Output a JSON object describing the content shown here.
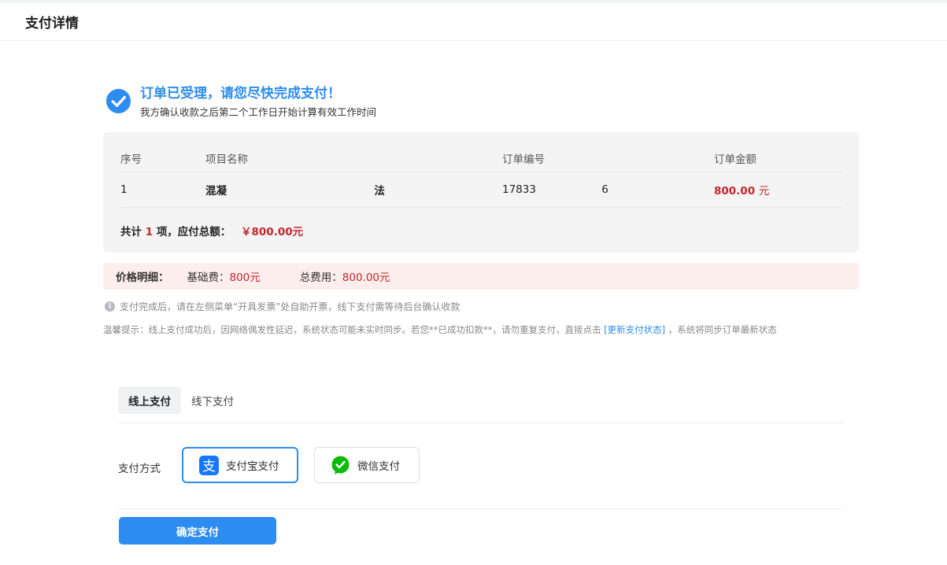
{
  "header": {
    "title": "支付详情"
  },
  "success": {
    "headline": "订单已受理，请您尽快完成支付！",
    "subline": "我方确认收款之后第二个工作日开始计算有效工作时间"
  },
  "order": {
    "columns": {
      "seq": "序号",
      "name": "项目名称",
      "no": "订单编号",
      "amount": "订单金额"
    },
    "row": {
      "seq": "1",
      "name_start": "混凝",
      "name_end": "法",
      "no_start": "17833",
      "no_end": "6",
      "amount": "800.00",
      "amount_unit": "元"
    },
    "total": {
      "prefix": "共计",
      "count": "1",
      "middle": "项，应付总额：",
      "money": "￥800.00元"
    }
  },
  "price_detail": {
    "label": "价格明细：",
    "base_key": "基础费：",
    "base_val": "800元",
    "sum_key": "总费用：",
    "sum_val": "800.00元"
  },
  "notice": "支付完成后，请在左侧菜单“开具发票”处自助开票，线下支付需等待后台确认收款",
  "tip": {
    "before": "温馨提示：线上支付成功后，因网络偶发性延迟，系统状态可能未实时同步。若您**已成功扣款**，请勿重复支付，直接点击",
    "link": "[更新支付状态]",
    "after": "，系统将同步订单最新状态"
  },
  "tabs": [
    {
      "label": "线上支付",
      "active": true
    },
    {
      "label": "线下支付",
      "active": false
    }
  ],
  "payment": {
    "label": "支付方式",
    "alipay": "支付宝支付",
    "wechat": "微信支付"
  },
  "confirm_label": "确定支付",
  "colors": {
    "primary": "#2d8cf0",
    "price": "#c3272b",
    "alipay": "#1677ff",
    "wechat": "#09bb07"
  }
}
